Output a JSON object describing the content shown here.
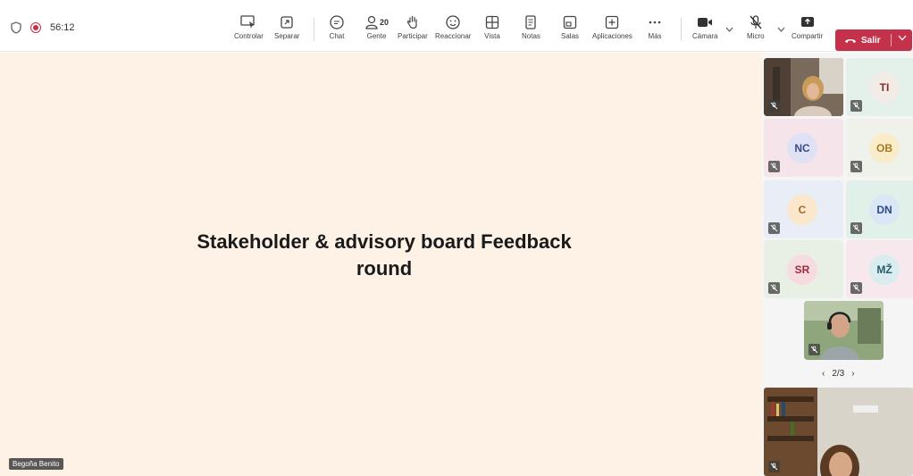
{
  "meeting": {
    "timer": "56:12",
    "presenter_name": "Begoña Benito"
  },
  "toolbar": {
    "controlar": "Controlar",
    "separar": "Separar",
    "chat": "Chat",
    "gente": "Gente",
    "gente_count": "20",
    "participar": "Participar",
    "reaccionar": "Reaccionar",
    "vista": "Vista",
    "notas": "Notas",
    "salas": "Salas",
    "aplicaciones": "Aplicaciones",
    "mas": "Más",
    "camara": "Cámara",
    "micro": "Micro",
    "compartir": "Compartir",
    "salir": "Salir"
  },
  "slide": {
    "line1": "Stakeholder & advisory board Feedback",
    "line2": "round"
  },
  "participants": [
    {
      "initials": "TI",
      "color": "#8a2a2a",
      "bg": "#e4f1ea",
      "avatar_bg": "#f3ece6"
    },
    {
      "initials": "NC",
      "color": "#3b4a8a",
      "bg": "#f5e4ea",
      "avatar_bg": "#dfe2f5"
    },
    {
      "initials": "OB",
      "color": "#a8791e",
      "bg": "#eef2ea",
      "avatar_bg": "#faecc9"
    },
    {
      "initials": "C",
      "color": "#a8691e",
      "bg": "#e8edf6",
      "avatar_bg": "#fbe7cc"
    },
    {
      "initials": "DN",
      "color": "#2a4a8a",
      "bg": "#e2f0ea",
      "avatar_bg": "#dbe6f6"
    },
    {
      "initials": "SR",
      "color": "#a02a3a",
      "bg": "#e8f0e6",
      "avatar_bg": "#f6dbe0"
    },
    {
      "initials": "MŽ",
      "color": "#2a5a6a",
      "bg": "#f6e8ec",
      "avatar_bg": "#d9ecef"
    }
  ],
  "pager": {
    "label": "2/3"
  },
  "colors": {
    "accent_red": "#c4314b",
    "stage_bg": "#fdf2e5"
  }
}
